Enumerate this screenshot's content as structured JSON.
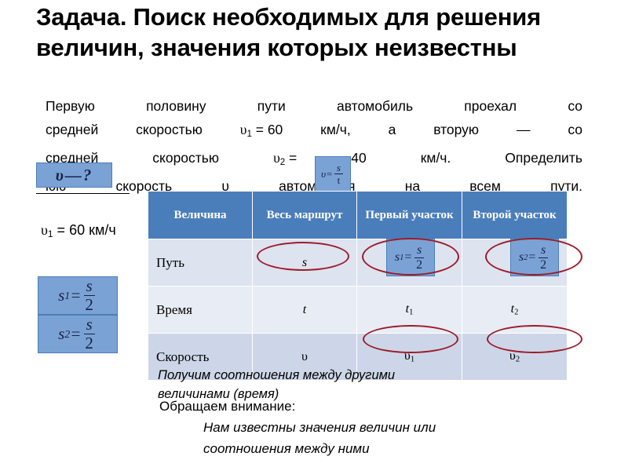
{
  "slide": {
    "title": "Задача. Поиск необходимых для решения величин, значения которых неизвестны"
  },
  "statement": {
    "line1": "Первую половину пути автомобиль проехал со",
    "line1_words": [
      "Первую",
      "половину",
      "пути",
      "автомобиль",
      "проехал",
      "со"
    ],
    "line2_words": [
      "средней",
      "скоростью",
      "υ₁ = 60",
      "км/ч,",
      "а",
      "вторую",
      "—",
      "со"
    ],
    "line3_words": [
      "средней",
      "скоростью",
      "υ₂ =",
      "40",
      "км/ч.",
      "Определить"
    ],
    "line4": "среднюю скорость υ автомобиля на всем пути.",
    "line4_visible": "юю скорость υ автомобиля на всем пути.",
    "v1_symbol": "υ",
    "v1_sub": "1",
    "v1_value": "60",
    "v2_symbol": "υ",
    "v2_sub": "2",
    "v2_value": "40",
    "unit": "км/ч"
  },
  "boxes": {
    "v_unknown": {
      "lhs": "υ",
      "dash": "—",
      "rhs": "?"
    },
    "v_formula": {
      "lhs": "υ",
      "eq": "=",
      "num": "s",
      "den": "t"
    },
    "s1_left": {
      "lhs": "s",
      "sub": "1",
      "eq": "=",
      "num": "s",
      "den": "2"
    },
    "s2_left": {
      "lhs": "s",
      "sub": "2",
      "eq": "=",
      "num": "s",
      "den": "2"
    },
    "s1_cell": {
      "lhs": "s",
      "sub": "1",
      "eq": "=",
      "num": "s",
      "den": "2"
    },
    "s2_cell": {
      "lhs": "s",
      "sub": "2",
      "eq": "=",
      "num": "s",
      "den": "2"
    }
  },
  "given": {
    "symbol": "υ",
    "sub": "1",
    "eq": "=",
    "value": "60",
    "unit": "км/ч",
    "text": "υ₁ = 60 км/ч"
  },
  "table": {
    "headers": [
      "Величина",
      "Весь маршрут",
      "Первый участок",
      "Второй участок"
    ],
    "rows": [
      {
        "label": "Путь",
        "whole": "s",
        "first": "s₁ = s/2",
        "second": "s₂ = s/2"
      },
      {
        "label": "Время",
        "whole": "t",
        "first_base": "t",
        "first_sub": "1",
        "second_base": "t",
        "second_sub": "2"
      },
      {
        "label": "Скорость",
        "whole": "υ",
        "first_base": "υ",
        "first_sub": "1",
        "second_base": "υ",
        "second_sub": "2"
      }
    ]
  },
  "notes": {
    "note_a_line1": "Получим соотношения между другими",
    "note_a_line2": "величинами (время)",
    "note_b_header": "Обращаем внимание:",
    "note_b_line1": "Нам известны значения величин или",
    "note_b_line2": "соотношения между ними"
  },
  "colors": {
    "box_fill": "#7ba2d4",
    "box_border": "#4a7ebb",
    "table_header": "#4a7ebb",
    "table_row_light": "#e8ecf5",
    "table_row_mid": "#dde3ef",
    "table_row_dark": "#ccd6e8",
    "ellipse": "#9c1c28",
    "text": "#000000"
  }
}
